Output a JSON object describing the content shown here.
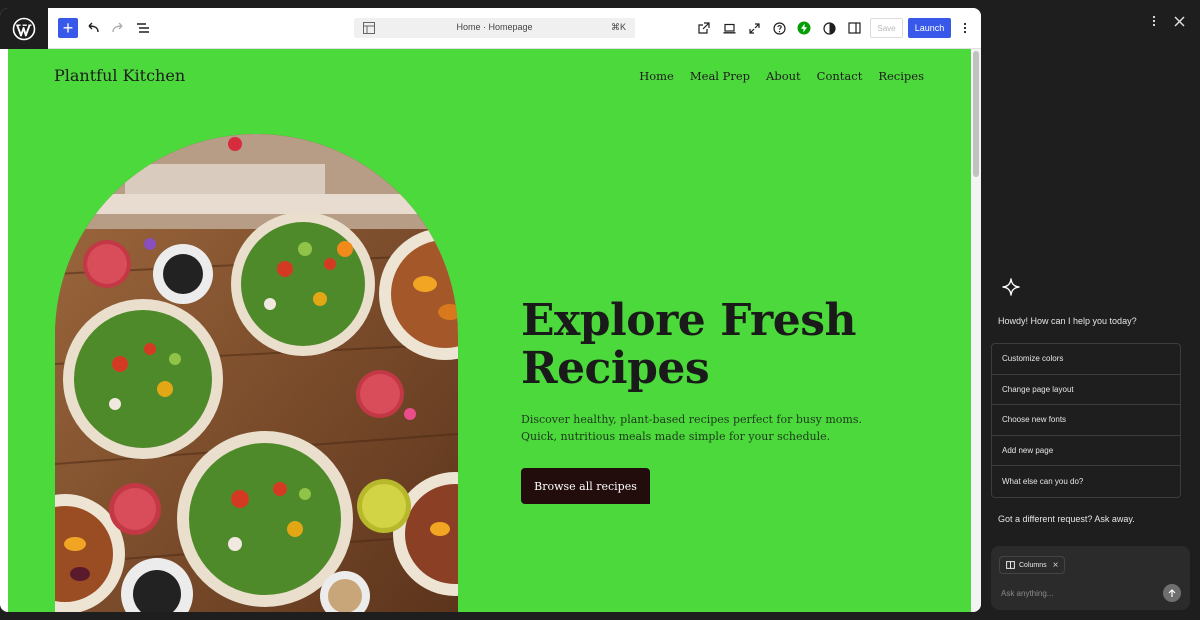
{
  "editor_toolbar": {
    "document_title": "Home · Homepage",
    "command_shortcut": "⌘K",
    "save_label": "Save",
    "launch_label": "Launch",
    "accent_color": "#3858e9"
  },
  "site": {
    "title": "Plantful Kitchen",
    "nav": [
      "Home",
      "Meal Prep",
      "About",
      "Contact",
      "Recipes"
    ],
    "background_color": "#4cd93b"
  },
  "hero": {
    "heading": "Explore Fresh Recipes",
    "description": "Discover healthy, plant-based recipes perfect for busy moms. Quick, nutritious meals made simple for your schedule.",
    "cta_label": "Browse all recipes"
  },
  "assistant": {
    "greeting": "Howdy! How can I help you today?",
    "suggestions": [
      "Customize colors",
      "Change page layout",
      "Choose new fonts",
      "Add new page",
      "What else can you do?"
    ],
    "different_request": "Got a different request? Ask away.",
    "context_chip": "Columns",
    "input_placeholder": "Ask anything..."
  },
  "icons": {
    "logo": "wordpress-logo-icon",
    "add": "plus-icon",
    "undo": "undo-icon",
    "redo": "redo-icon",
    "list_view": "list-view-icon",
    "view_site": "external-link-icon",
    "device_preview": "laptop-icon",
    "fullscreen": "expand-icon",
    "help": "help-circle-icon",
    "jetpack": "bolt-circle-icon",
    "styles": "half-circle-icon",
    "settings": "sidebar-icon",
    "more": "more-vertical-icon",
    "close": "close-icon",
    "sparkle": "sparkle-icon",
    "columns": "columns-icon",
    "send": "arrow-up-icon"
  }
}
